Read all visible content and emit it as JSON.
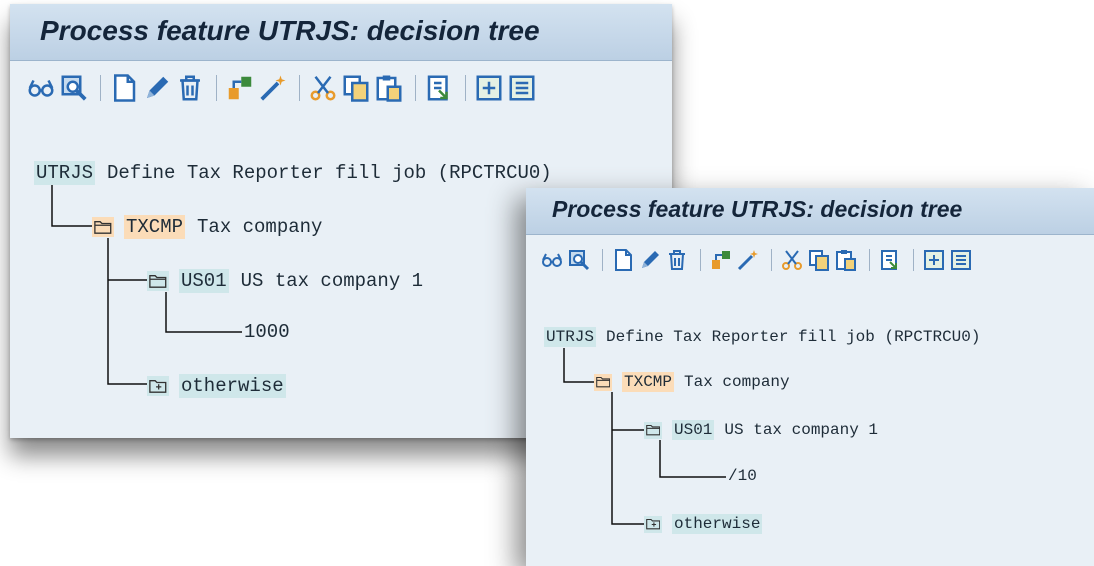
{
  "windows": [
    {
      "title": "Process feature UTRJS: decision tree",
      "toolbar": {
        "groups": [
          [
            "glasses-icon",
            "search-icon"
          ],
          [
            "new-document-icon",
            "pencil-icon",
            "trash-icon"
          ],
          [
            "structure-icon",
            "magic-wand-icon"
          ],
          [
            "scissors-icon",
            "copy-icon",
            "paste-icon"
          ],
          [
            "import-icon"
          ],
          [
            "expand-icon",
            "collapse-icon"
          ]
        ]
      },
      "tree": {
        "root": {
          "key": "UTRJS",
          "text": "Define Tax Reporter fill job (RPCTRCU0)"
        },
        "feature": {
          "key": "TXCMP",
          "text": "Tax company"
        },
        "value": {
          "key": "US01",
          "text": "US tax company 1"
        },
        "return_value": "1000",
        "otherwise": "otherwise"
      }
    },
    {
      "title": "Process feature UTRJS: decision tree",
      "toolbar": {
        "groups": [
          [
            "glasses-icon",
            "search-icon"
          ],
          [
            "new-document-icon",
            "pencil-icon",
            "trash-icon"
          ],
          [
            "structure-icon",
            "magic-wand-icon"
          ],
          [
            "scissors-icon",
            "copy-icon",
            "paste-icon"
          ],
          [
            "import-icon"
          ],
          [
            "expand-icon",
            "collapse-icon"
          ]
        ]
      },
      "tree": {
        "root": {
          "key": "UTRJS",
          "text": "Define Tax Reporter fill job (RPCTRCU0)"
        },
        "feature": {
          "key": "TXCMP",
          "text": "Tax company"
        },
        "value": {
          "key": "US01",
          "text": "US tax company 1"
        },
        "return_value": "/10",
        "otherwise": "otherwise"
      }
    }
  ]
}
